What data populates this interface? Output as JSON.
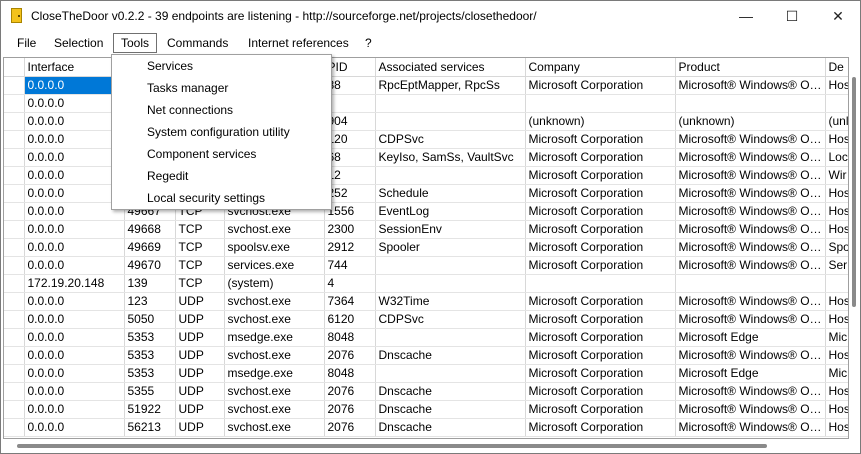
{
  "window": {
    "title": "CloseTheDoor v0.2.2 - 39 endpoints are listening - http://sourceforge.net/projects/closethedoor/",
    "minimize_glyph": "—",
    "maximize_glyph": "☐",
    "close_glyph": "✕"
  },
  "menubar": {
    "items": [
      "File",
      "Selection",
      "Tools",
      "Commands",
      "Internet references",
      "?"
    ],
    "active": "Tools"
  },
  "tools_menu": {
    "items": [
      "Services",
      "Tasks manager",
      "Net connections",
      "System configuration utility",
      "Component services",
      "Regedit",
      "Local security settings"
    ]
  },
  "table": {
    "columns": [
      "Interface",
      "",
      "",
      "",
      "PID",
      "Associated services",
      "Company",
      "Product",
      "De"
    ],
    "rows": [
      [
        "0.0.0.0",
        "",
        "",
        "",
        "88",
        "RpcEptMapper, RpcSs",
        "Microsoft Corporation",
        "Microsoft® Windows® Operating System",
        "Hos"
      ],
      [
        "0.0.0.0",
        "",
        "",
        "",
        "",
        "",
        "",
        "",
        ""
      ],
      [
        "0.0.0.0",
        "",
        "",
        "",
        "904",
        "",
        "(unknown)",
        "(unknown)",
        "(unl"
      ],
      [
        "0.0.0.0",
        "",
        "",
        "",
        "120",
        "CDPSvc",
        "Microsoft Corporation",
        "Microsoft® Windows® Operating System",
        "Hos"
      ],
      [
        "0.0.0.0",
        "",
        "",
        "",
        "68",
        "KeyIso, SamSs, VaultSvc",
        "Microsoft Corporation",
        "Microsoft® Windows® Operating System",
        "Loc"
      ],
      [
        "0.0.0.0",
        "",
        "",
        "",
        "12",
        "",
        "Microsoft Corporation",
        "Microsoft® Windows® Operating System",
        "Wir"
      ],
      [
        "0.0.0.0",
        "",
        "",
        "",
        "252",
        "Schedule",
        "Microsoft Corporation",
        "Microsoft® Windows® Operating System",
        "Hos"
      ],
      [
        "0.0.0.0",
        "49667",
        "TCP",
        "svchost.exe",
        "1556",
        "EventLog",
        "Microsoft Corporation",
        "Microsoft® Windows® Operating System",
        "Hos"
      ],
      [
        "0.0.0.0",
        "49668",
        "TCP",
        "svchost.exe",
        "2300",
        "SessionEnv",
        "Microsoft Corporation",
        "Microsoft® Windows® Operating System",
        "Hos"
      ],
      [
        "0.0.0.0",
        "49669",
        "TCP",
        "spoolsv.exe",
        "2912",
        "Spooler",
        "Microsoft Corporation",
        "Microsoft® Windows® Operating System",
        "Spo"
      ],
      [
        "0.0.0.0",
        "49670",
        "TCP",
        "services.exe",
        "744",
        "",
        "Microsoft Corporation",
        "Microsoft® Windows® Operating System",
        "Ser"
      ],
      [
        "172.19.20.148",
        "139",
        "TCP",
        "(system)",
        "4",
        "",
        "",
        "",
        ""
      ],
      [
        "0.0.0.0",
        "123",
        "UDP",
        "svchost.exe",
        "7364",
        "W32Time",
        "Microsoft Corporation",
        "Microsoft® Windows® Operating System",
        "Hos"
      ],
      [
        "0.0.0.0",
        "5050",
        "UDP",
        "svchost.exe",
        "6120",
        "CDPSvc",
        "Microsoft Corporation",
        "Microsoft® Windows® Operating System",
        "Hos"
      ],
      [
        "0.0.0.0",
        "5353",
        "UDP",
        "msedge.exe",
        "8048",
        "",
        "Microsoft Corporation",
        "Microsoft Edge",
        "Mic"
      ],
      [
        "0.0.0.0",
        "5353",
        "UDP",
        "svchost.exe",
        "2076",
        "Dnscache",
        "Microsoft Corporation",
        "Microsoft® Windows® Operating System",
        "Hos"
      ],
      [
        "0.0.0.0",
        "5353",
        "UDP",
        "msedge.exe",
        "8048",
        "",
        "Microsoft Corporation",
        "Microsoft Edge",
        "Mic"
      ],
      [
        "0.0.0.0",
        "5355",
        "UDP",
        "svchost.exe",
        "2076",
        "Dnscache",
        "Microsoft Corporation",
        "Microsoft® Windows® Operating System",
        "Hos"
      ],
      [
        "0.0.0.0",
        "51922",
        "UDP",
        "svchost.exe",
        "2076",
        "Dnscache",
        "Microsoft Corporation",
        "Microsoft® Windows® Operating System",
        "Hos"
      ],
      [
        "0.0.0.0",
        "56213",
        "UDP",
        "svchost.exe",
        "2076",
        "Dnscache",
        "Microsoft Corporation",
        "Microsoft® Windows® Operating System",
        "Hos"
      ]
    ]
  }
}
